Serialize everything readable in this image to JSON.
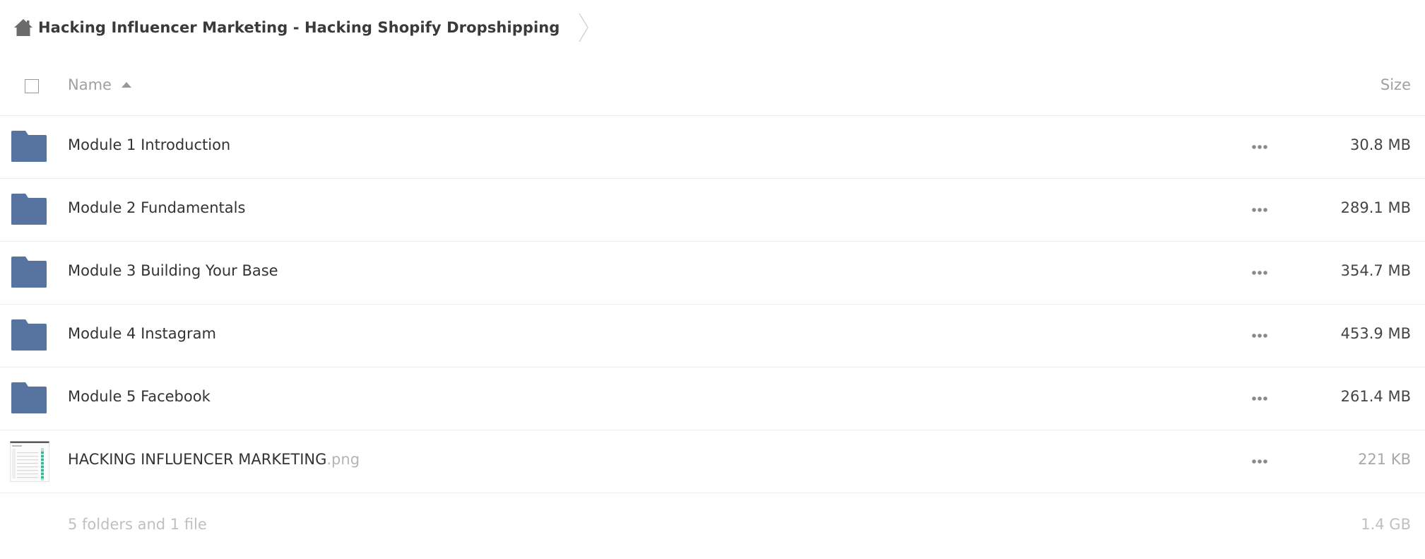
{
  "breadcrumb": {
    "home_icon": "home-icon",
    "current": "Hacking Influencer Marketing - Hacking Shopify Dropshipping"
  },
  "header": {
    "name_label": "Name",
    "size_label": "Size",
    "sort": "ascending"
  },
  "files": [
    {
      "type": "folder",
      "name": "Module 1 Introduction",
      "ext": "",
      "size": "30.8 MB"
    },
    {
      "type": "folder",
      "name": "Module 2 Fundamentals",
      "ext": "",
      "size": "289.1 MB"
    },
    {
      "type": "folder",
      "name": "Module 3 Building Your Base",
      "ext": "",
      "size": "354.7 MB"
    },
    {
      "type": "folder",
      "name": "Module 4 Instagram",
      "ext": "",
      "size": "453.9 MB"
    },
    {
      "type": "folder",
      "name": "Module 5 Facebook",
      "ext": "",
      "size": "261.4 MB"
    },
    {
      "type": "file",
      "name": "HACKING INFLUENCER MARKETING",
      "ext": ".png",
      "size": "221 KB"
    }
  ],
  "summary": {
    "count": "5 folders and 1 file",
    "total": "1.4 GB"
  },
  "colors": {
    "folder": "#56749f",
    "accent": "#2fb89a"
  }
}
